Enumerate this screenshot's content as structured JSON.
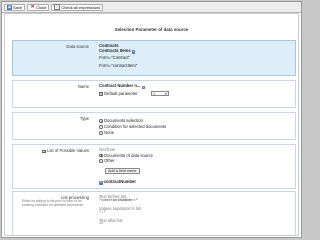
{
  "toolbar": {
    "save_label": "Save",
    "close_label": "Close",
    "check_all_label": "Check all expressions"
  },
  "page_title": "Selection Parameter of data source",
  "data_source": {
    "label": "Data source",
    "name": "Contracts",
    "subtitle": "Contracts Items",
    "form_line1": "Form=\"Contract\"",
    "form_line2": "Form=\"contractItem\""
  },
  "name_row": {
    "label": "Name",
    "value": "Contract Number n...",
    "default_param_label": "Default parameter",
    "select_value": "1"
  },
  "type_row": {
    "label": "Type",
    "options": [
      "Documents selection",
      "Condition for selected documents",
      "None"
    ]
  },
  "list_values": {
    "label": "List of Possible Values",
    "get_from_label": "Get from",
    "options": [
      "Documents of data source",
      "Other"
    ],
    "add_field_button": "Add a field name",
    "field_name": "contractNumber"
  },
  "list_processing": {
    "label": "List processing",
    "hint": "Either by adding to list prior to form or for entering condition for selected documents",
    "text_before_label": "Text before list",
    "text_before_value": "\"contractNumber=\"",
    "separator_label": "Values separator in list",
    "separator_value": "\";\"",
    "text_after_label": "Text after list",
    "text_after_value": "\"\""
  }
}
